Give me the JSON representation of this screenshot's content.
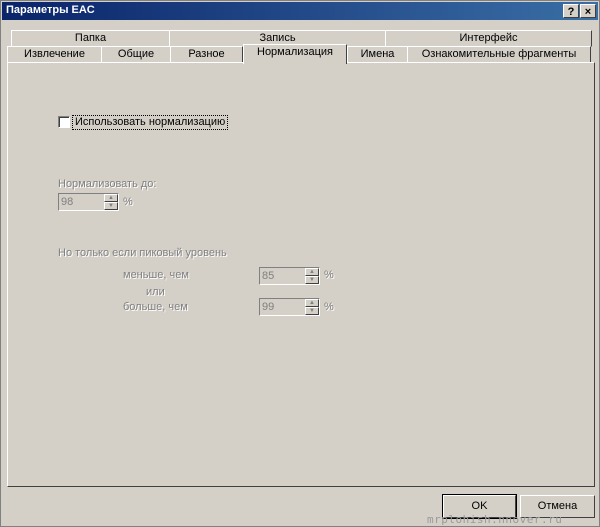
{
  "window": {
    "title": "Параметры EAC",
    "help_btn": "?",
    "close_btn": "×"
  },
  "tabs_row1": [
    "Папка",
    "Запись",
    "Интерфейс"
  ],
  "tabs_row2": [
    "Извлечение",
    "Общие",
    "Разное",
    "Нормализация",
    "Имена",
    "Ознакомительные фрагменты"
  ],
  "active_tab": "Нормализация",
  "normalization": {
    "use_normalization_label": "Использовать нормализацию",
    "use_normalization_checked": false,
    "normalize_to_label": "Нормализовать до:",
    "normalize_to_value": "98",
    "percent": "%",
    "peak_condition_label": "Но только если пиковый уровень",
    "less_than_label": "меньше, чем",
    "less_than_value": "85",
    "or_label": "или",
    "greater_than_label": "больше, чем",
    "greater_than_value": "99"
  },
  "buttons": {
    "ok": "OK",
    "cancel": "Отмена"
  },
  "watermark": "mrplohish.nnover.ru"
}
